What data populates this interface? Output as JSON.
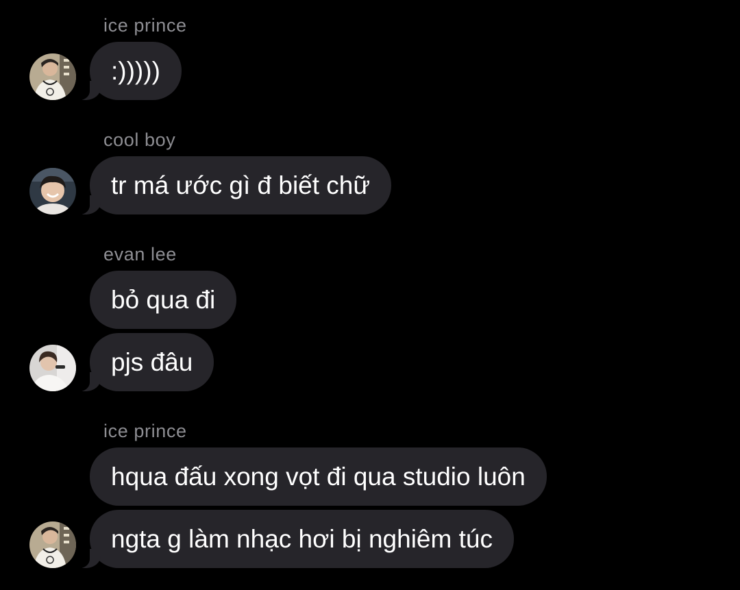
{
  "thread": {
    "groups": [
      {
        "sender": "ice prince",
        "avatar_icon": "ice-prince-avatar",
        "messages": [
          ":)))))"
        ]
      },
      {
        "sender": "cool boy",
        "avatar_icon": "cool-boy-avatar",
        "messages": [
          "tr má ước gì đ biết chữ"
        ]
      },
      {
        "sender": "evan lee",
        "avatar_icon": "evan-lee-avatar",
        "messages": [
          "bỏ qua đi",
          "pjs đâu"
        ]
      },
      {
        "sender": "ice prince",
        "avatar_icon": "ice-prince-avatar",
        "messages": [
          "hqua đấu xong vọt đi qua studio luôn",
          "ngta g làm nhạc hơi bị nghiêm túc"
        ]
      }
    ]
  },
  "colors": {
    "background": "#000000",
    "bubble": "#26252a",
    "sender_name": "#8e8e93",
    "message_text": "#ffffff"
  }
}
